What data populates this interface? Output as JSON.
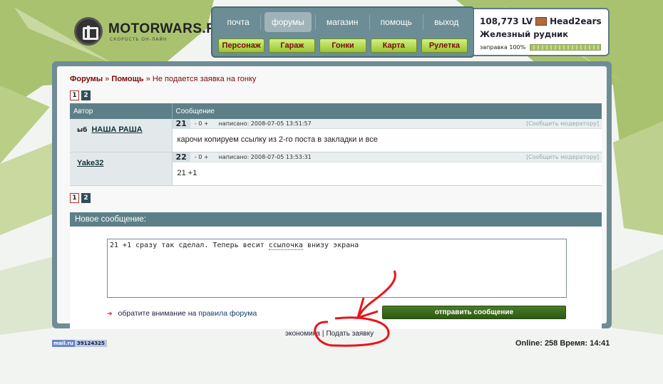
{
  "logo": {
    "title": "MOTORWARS.RU",
    "subtitle": "СКОРОСТЬ ОН-ЛАЙН"
  },
  "nav": {
    "top": [
      "почта",
      "форумы",
      "магазин",
      "помощь",
      "выход"
    ],
    "active_index": 1,
    "sub": [
      "Персонаж",
      "Гараж",
      "Гонки",
      "Карта",
      "Рулетка"
    ]
  },
  "user": {
    "money": "108,773 LV",
    "name": "Head2ears",
    "location": "Железный рудник",
    "fuel_label": "заправка 100%",
    "fuel_fraction": 1.0
  },
  "breadcrumb": {
    "part1": "Форумы",
    "sep": " » ",
    "part2": "Помощь",
    "part3": "Не подается заявка на гонку"
  },
  "pager": {
    "pages": [
      "1",
      "2"
    ],
    "current": "1"
  },
  "table": {
    "col_author": "Автор",
    "col_message": "Сообщение"
  },
  "posts": [
    {
      "prefix": "ыб",
      "author": "НАША РАША",
      "num": "21",
      "rating": "- 0 +",
      "posted": "написано: 2008-07-05 13:51:57",
      "report": "[Сообщить модератору]",
      "text": "карочи копируем ссылку из 2-го поста в закладки и все"
    },
    {
      "prefix": "",
      "author": "Yake32",
      "num": "22",
      "rating": "- 0 +",
      "posted": "написано: 2008-07-05 13:53:31",
      "report": "[Сообщить модератору]",
      "text": "21 +1"
    }
  ],
  "compose": {
    "title": "Новое сообщение:",
    "text_before": "21 +1 сразу так сделал. Теперь весит ",
    "text_misspelled": "ссылочка",
    "text_after": " внизу экрана",
    "rules_prefix": "обратите внимание на",
    "rules_link": "правила форума",
    "send": "отправить сообщение"
  },
  "footer": {
    "link1": "экономика",
    "sep": "|",
    "link2": "Подать заявку",
    "counter_left": "mail.ru",
    "counter_right": "39124325",
    "online": "Online: 258  Время: 14:41"
  },
  "colors": {
    "panel": "#6f8d95",
    "header_row": "#5d7f88",
    "accent_green": "#9cc535",
    "brand_red": "#7a0b0b"
  }
}
